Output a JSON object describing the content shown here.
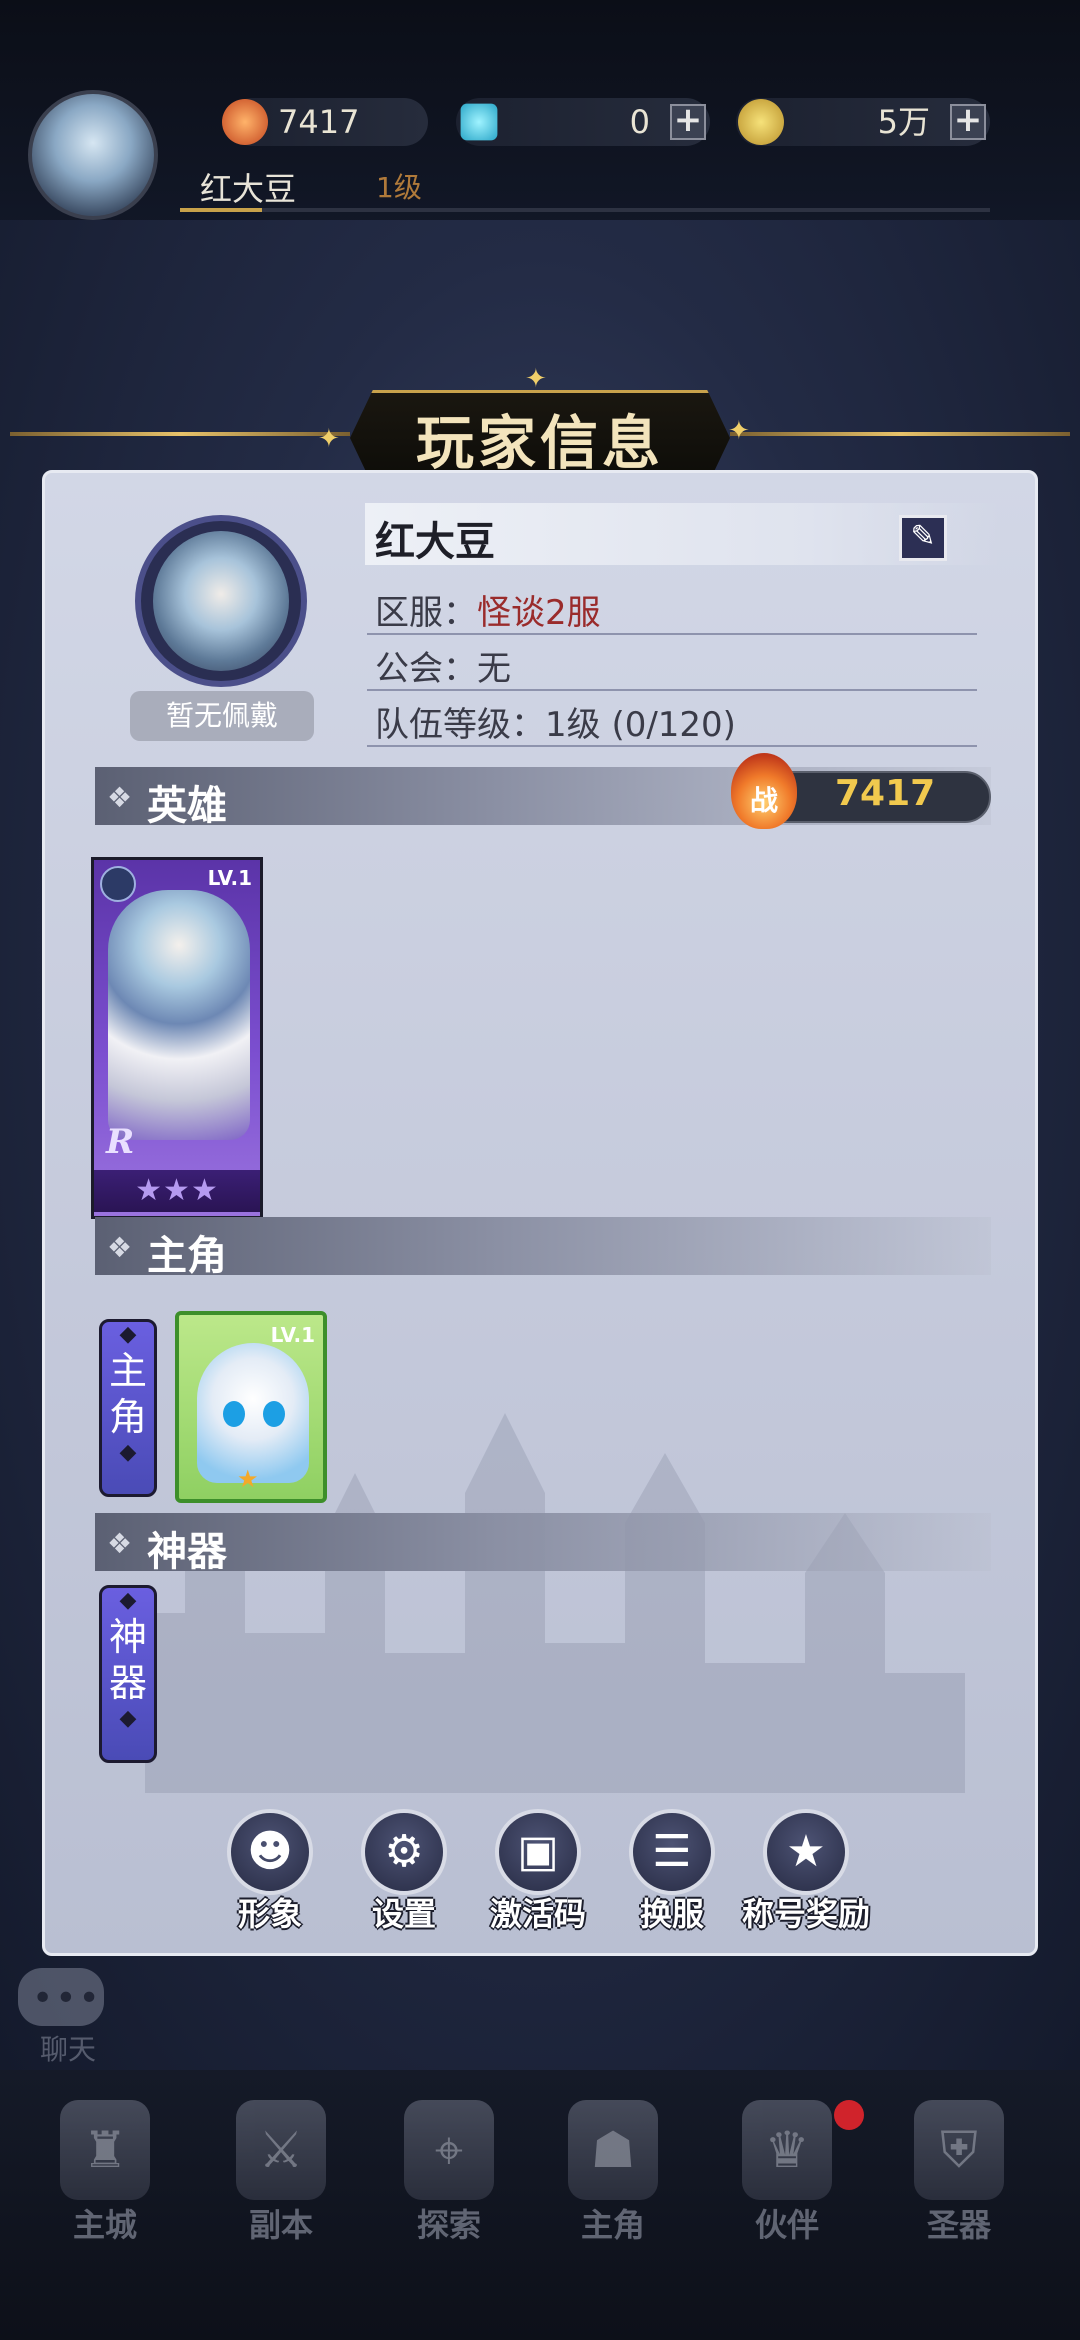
{
  "topbar": {
    "combat_power": "7417",
    "diamonds": "0",
    "gold": "5万",
    "player_name": "红大豆",
    "player_level": "1级"
  },
  "title": "玩家信息",
  "profile": {
    "no_wear_label": "暂无佩戴",
    "name": "红大豆",
    "server_label": "区服：",
    "server_value": "怪谈2服",
    "guild_label": "公会：",
    "guild_value": "无",
    "team_level_label": "队伍等级：",
    "team_level_value": "1级  (0/120)"
  },
  "sections": {
    "heroes": "英雄",
    "protagonist": "主角",
    "artifact": "神器"
  },
  "power_badge": {
    "glyph": "战",
    "value": "7417"
  },
  "hero_card": {
    "level": "LV.1",
    "rarity": "R",
    "stars": "★★★"
  },
  "protagonist_tag": {
    "char1": "主",
    "char2": "角"
  },
  "artifact_tag": {
    "char1": "神",
    "char2": "器"
  },
  "protagonist_card": {
    "level": "LV.1",
    "stars": "★"
  },
  "actions": [
    {
      "label": "形象",
      "icon": "avatar-icon"
    },
    {
      "label": "设置",
      "icon": "gear-icon"
    },
    {
      "label": "激活码",
      "icon": "gift-code-icon"
    },
    {
      "label": "换服",
      "icon": "server-switch-icon"
    },
    {
      "label": "称号奖励",
      "icon": "title-reward-icon"
    }
  ],
  "chat": {
    "label": "聊天"
  },
  "bottom_nav": [
    {
      "label": "主城",
      "icon": "castle-icon"
    },
    {
      "label": "副本",
      "icon": "dungeon-icon"
    },
    {
      "label": "探索",
      "icon": "compass-icon"
    },
    {
      "label": "主角",
      "icon": "protagonist-icon"
    },
    {
      "label": "伙伴",
      "icon": "crown-icon"
    },
    {
      "label": "圣器",
      "icon": "helmet-lock-icon"
    }
  ],
  "colors": {
    "accent_gold": "#c9a24c",
    "server_red": "#9a2b2b",
    "power_yellow": "#f1c94e",
    "notification_red": "#d0232b"
  }
}
